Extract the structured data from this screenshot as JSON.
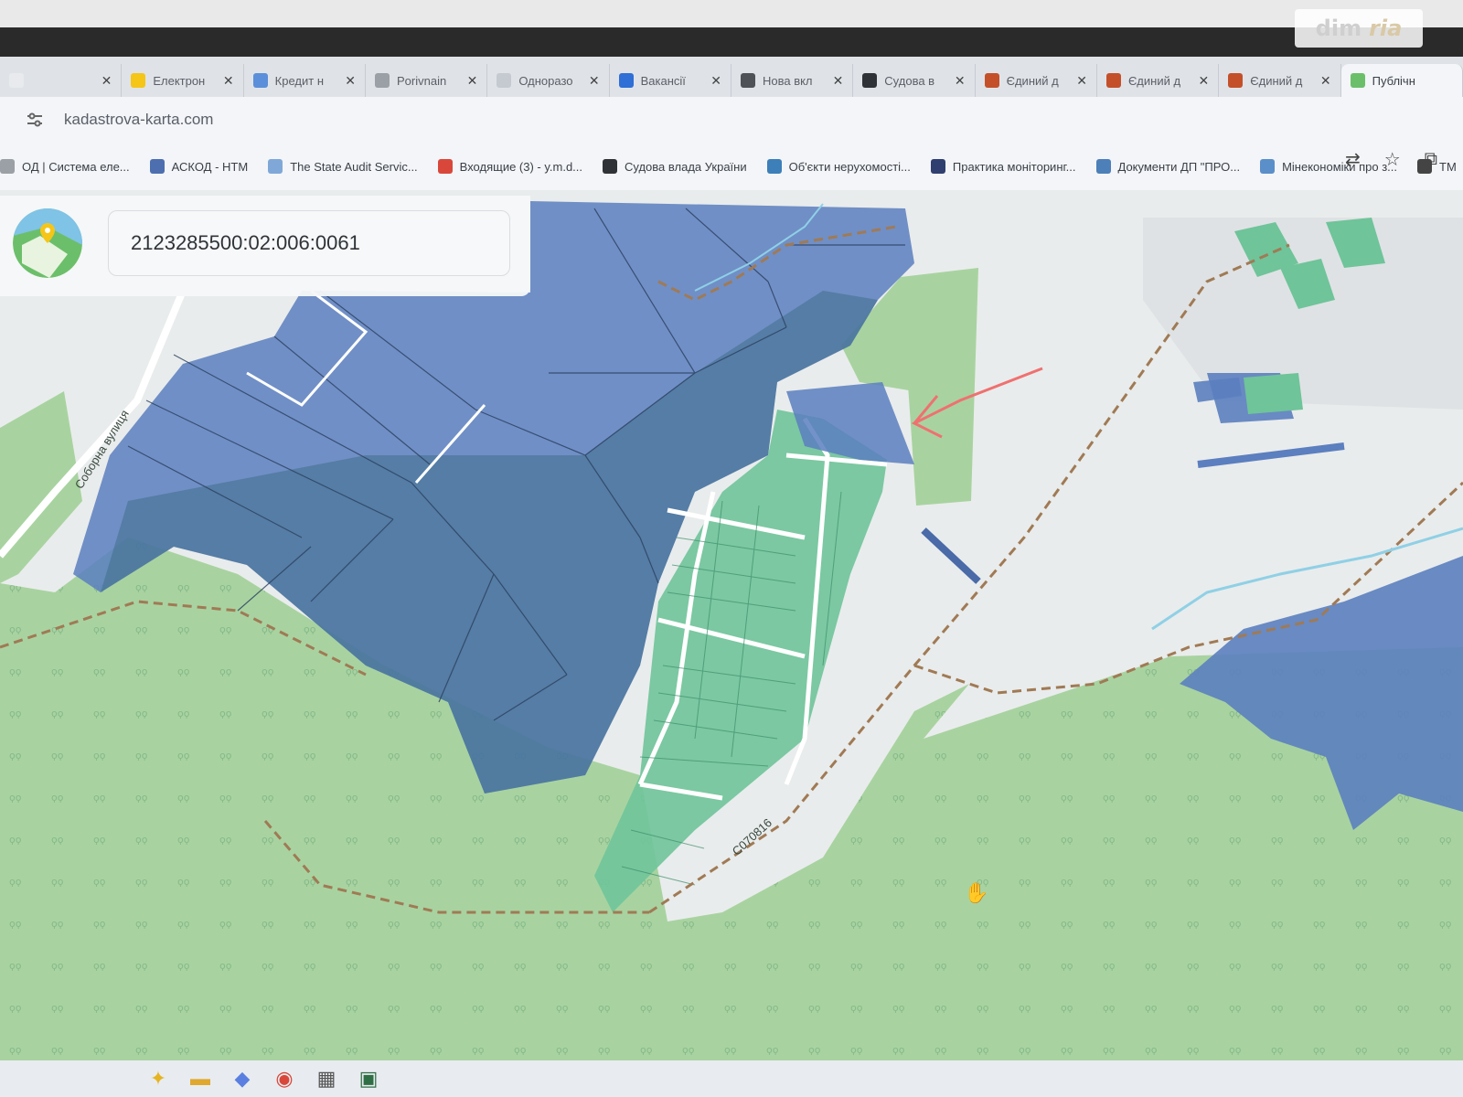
{
  "watermark": {
    "left": "dim",
    "right": "ria"
  },
  "tabs": [
    {
      "title": "",
      "icon": "tab-icon",
      "color": "#e8eaed"
    },
    {
      "title": "Електрон",
      "icon": "ukraine-flag-icon",
      "color": "#f5c518"
    },
    {
      "title": "Кредит н",
      "icon": "grid-icon",
      "color": "#5b8fd9"
    },
    {
      "title": "Porivnain",
      "icon": "globe-icon",
      "color": "#9aa0a6"
    },
    {
      "title": "Одноразо",
      "icon": "document-icon",
      "color": "#c5cad1"
    },
    {
      "title": "Вакансії",
      "icon": "ukraine-flag-icon",
      "color": "#2f6fd6"
    },
    {
      "title": "Нова вкл",
      "icon": "chrome-icon",
      "color": "#4f5256"
    },
    {
      "title": "Судова в",
      "icon": "justice-icon",
      "color": "#2f3338"
    },
    {
      "title": "Єдиний д",
      "icon": "gavel-icon",
      "color": "#c4502a"
    },
    {
      "title": "Єдиний д",
      "icon": "gavel-icon",
      "color": "#c4502a"
    },
    {
      "title": "Єдиний д",
      "icon": "gavel-icon",
      "color": "#c4502a"
    },
    {
      "title": "Публічн",
      "icon": "map-logo-icon",
      "color": "#6cbf6a",
      "active": true
    }
  ],
  "address": {
    "url": "kadastrova-karta.com"
  },
  "bookmarks": [
    {
      "label": "ОД | Система еле...",
      "icon": "system-icon"
    },
    {
      "label": "АСКОД - НТМ",
      "icon": "askod-icon"
    },
    {
      "label": "The State Audit Servic...",
      "icon": "audit-icon"
    },
    {
      "label": "Входящие (3) - y.m.d...",
      "icon": "gmail-icon"
    },
    {
      "label": "Судова влада України",
      "icon": "justice-icon"
    },
    {
      "label": "Об'єкти нерухомості...",
      "icon": "building-icon"
    },
    {
      "label": "Практика моніторинг...",
      "icon": "play-icon"
    },
    {
      "label": "Документи ДП \"ПРО...",
      "icon": "diamond-icon"
    },
    {
      "label": "Мінекономіки про з...",
      "icon": "ministry-icon"
    },
    {
      "label": "TM",
      "icon": "tm-icon"
    }
  ],
  "search": {
    "query": "2123285500:02:006:0061"
  },
  "map": {
    "street_label": "Соборна вулиця",
    "road_label": "С070816",
    "colors": {
      "forest": "#a8d3a0",
      "blue_parcel": "#5b7fbf",
      "green_parcel": "#6fc49a",
      "annotation_arrow": "#f07070"
    }
  },
  "taskbar": {
    "items": [
      "copilot-icon",
      "file-explorer-icon",
      "copilot-app-icon",
      "chrome-icon",
      "calculator-icon",
      "excel-icon"
    ]
  }
}
